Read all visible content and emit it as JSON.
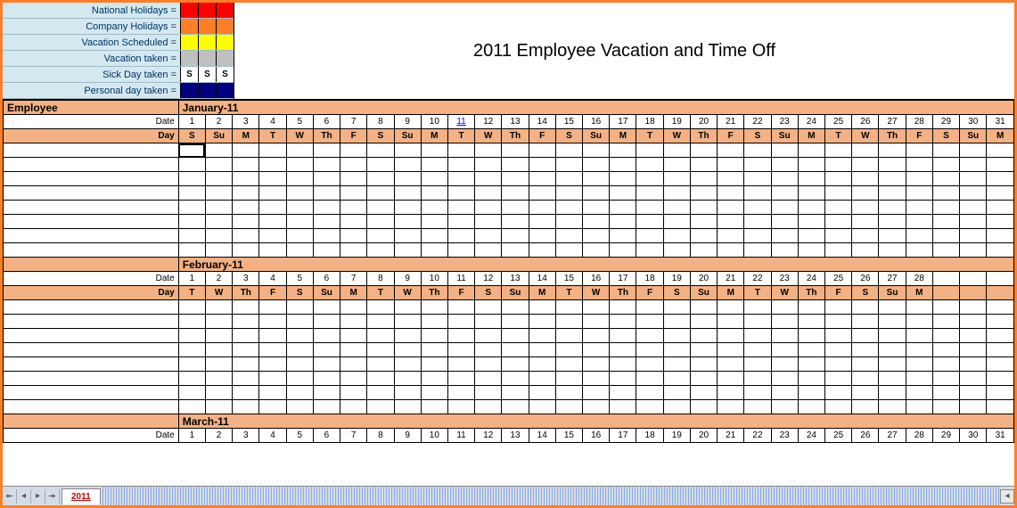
{
  "title": "2011 Employee Vacation and Time Off",
  "legend": {
    "rows": [
      {
        "label": "National Holidays =",
        "color": "#ff0000",
        "text": ""
      },
      {
        "label": "Company Holidays =",
        "color": "#ff7f27",
        "text": ""
      },
      {
        "label": "Vacation Scheduled =",
        "color": "#ffff00",
        "text": ""
      },
      {
        "label": "Vacation taken =",
        "color": "#c0c0c0",
        "text": ""
      },
      {
        "label": "Sick Day taken =",
        "color": "#ffffff",
        "text": "S"
      },
      {
        "label": "Personal day taken =",
        "color": "#000080",
        "text": ""
      }
    ]
  },
  "headers": {
    "employee": "Employee",
    "date": "Date",
    "day": "Day"
  },
  "months": [
    {
      "name": "January-11",
      "dates": [
        1,
        2,
        3,
        4,
        5,
        6,
        7,
        8,
        9,
        10,
        11,
        12,
        13,
        14,
        15,
        16,
        17,
        18,
        19,
        20,
        21,
        22,
        23,
        24,
        25,
        26,
        27,
        28,
        29,
        30,
        31
      ],
      "days": [
        "S",
        "Su",
        "M",
        "T",
        "W",
        "Th",
        "F",
        "S",
        "Su",
        "M",
        "T",
        "W",
        "Th",
        "F",
        "S",
        "Su",
        "M",
        "T",
        "W",
        "Th",
        "F",
        "S",
        "Su",
        "M",
        "T",
        "W",
        "Th",
        "F",
        "S",
        "Su",
        "M"
      ],
      "link_dates": [
        11
      ],
      "empty_rows": 8,
      "selected": [
        0,
        0
      ]
    },
    {
      "name": "February-11",
      "dates": [
        1,
        2,
        3,
        4,
        5,
        6,
        7,
        8,
        9,
        10,
        11,
        12,
        13,
        14,
        15,
        16,
        17,
        18,
        19,
        20,
        21,
        22,
        23,
        24,
        25,
        26,
        27,
        28
      ],
      "days": [
        "T",
        "W",
        "Th",
        "F",
        "S",
        "Su",
        "M",
        "T",
        "W",
        "Th",
        "F",
        "S",
        "Su",
        "M",
        "T",
        "W",
        "Th",
        "F",
        "S",
        "Su",
        "M",
        "T",
        "W",
        "Th",
        "F",
        "S",
        "Su",
        "M"
      ],
      "link_dates": [],
      "empty_rows": 8
    },
    {
      "name": "March-11",
      "dates": [
        1,
        2,
        3,
        4,
        5,
        6,
        7,
        8,
        9,
        10,
        11,
        12,
        13,
        14,
        15,
        16,
        17,
        18,
        19,
        20,
        21,
        22,
        23,
        24,
        25,
        26,
        27,
        28,
        29,
        30,
        31
      ],
      "days": [],
      "link_dates": [],
      "empty_rows": 0
    }
  ],
  "tabs": {
    "active": "2011"
  }
}
